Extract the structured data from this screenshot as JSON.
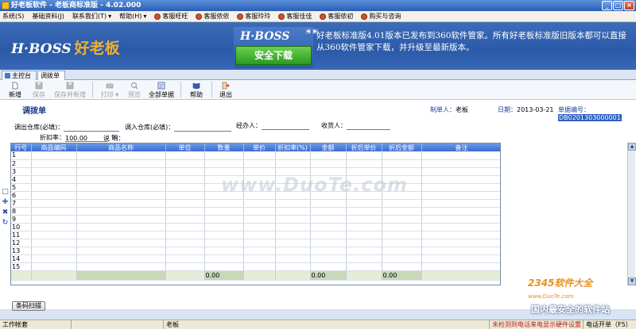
{
  "window": {
    "title": "好老板软件 - 老板商标准版 - 4.02.000",
    "controls": [
      "_",
      "□",
      "×"
    ]
  },
  "menu": [
    {
      "label": "系统(S)",
      "icon": ""
    },
    {
      "label": "基础资料(J)",
      "icon": ""
    },
    {
      "label": "联系我们(T)",
      "icon": ""
    },
    {
      "label": "帮助(H)",
      "icon": "dropdown"
    },
    {
      "label": "客服旺旺",
      "icon": "service-icon"
    },
    {
      "label": "客服依依",
      "icon": "service-icon"
    },
    {
      "label": "客服玲玲",
      "icon": "service-icon"
    },
    {
      "label": "客服佳佳",
      "icon": "service-icon"
    },
    {
      "label": "客服依初",
      "icon": "service-icon"
    },
    {
      "label": "购买与咨询",
      "icon": "service-icon"
    }
  ],
  "banner": {
    "logo_text": "H·BOSS",
    "logo_cn": "好老板",
    "ad_logo": "H·BOSS",
    "ad_button": "安全下载",
    "ad_text": "好老板标准版4.01版本已发布到360软件管家。所有好老板标准版旧版本都可以直接从360软件管家下载，并升级至最新版本。"
  },
  "tabs": [
    {
      "label": "主控台",
      "active": false
    },
    {
      "label": "调拨单",
      "active": true
    }
  ],
  "toolbar": [
    {
      "label": "新增",
      "enabled": true,
      "icon": "new-icon"
    },
    {
      "label": "保存",
      "enabled": false,
      "icon": "save-icon"
    },
    {
      "label": "保存并新增",
      "enabled": false,
      "icon": "save-new-icon"
    },
    {
      "label": "打印",
      "enabled": false,
      "icon": "print-icon"
    },
    {
      "label": "预览",
      "enabled": false,
      "icon": "preview-icon"
    },
    {
      "label": "全部单据",
      "enabled": true,
      "icon": "all-docs-icon"
    },
    {
      "label": "帮助",
      "enabled": true,
      "icon": "help-icon"
    },
    {
      "label": "退出",
      "enabled": true,
      "icon": "exit-icon"
    }
  ],
  "form": {
    "title": "调拨单",
    "creator_label": "制单人：",
    "creator_value": "老板",
    "date_label": "日期：",
    "date_value": "2013-03-21",
    "docno_label": "单据编号：",
    "docno_value": "DB0201303000001",
    "out_wh_label": "调出仓库(必填)：",
    "in_wh_label": "调入仓库(必填)：",
    "handler_label": "经办人：",
    "receiver_label": "收货人：",
    "discount_label": "折扣率：",
    "discount_value": "100.00",
    "percent": "%",
    "note_label": "说  明："
  },
  "grid": {
    "columns": [
      "行号",
      "商品编码",
      "商品名称",
      "单位",
      "数量",
      "单价",
      "折扣率(%)",
      "金额",
      "折后单价",
      "折后金额",
      "备注"
    ],
    "rows": [
      "1",
      "2",
      "3",
      "4",
      "5",
      "6",
      "7",
      "8",
      "9",
      "10",
      "11",
      "12",
      "13",
      "14",
      "15"
    ],
    "totals": {
      "quantity": "0.00",
      "amount": "0.00",
      "disc_amount": "0.00"
    }
  },
  "barcode_button": "条码扫描",
  "watermarks": {
    "center": "www.DuoTe.com",
    "brand": "2345软件大全",
    "brand_sub": "www.DuoTe.com",
    "bottom": "国内最安全的软件站"
  },
  "status": {
    "work_account": "工作帐套",
    "user": "老板",
    "warning": "未检测到电话来电显示硬件设置",
    "phone_shortcut": "电话开单（F5）"
  },
  "colors": {
    "banner": "#2a5aa8",
    "grid_header": "#4a7ad8",
    "logo_accent": "#f0b030",
    "download_btn": "#2a9a20"
  }
}
